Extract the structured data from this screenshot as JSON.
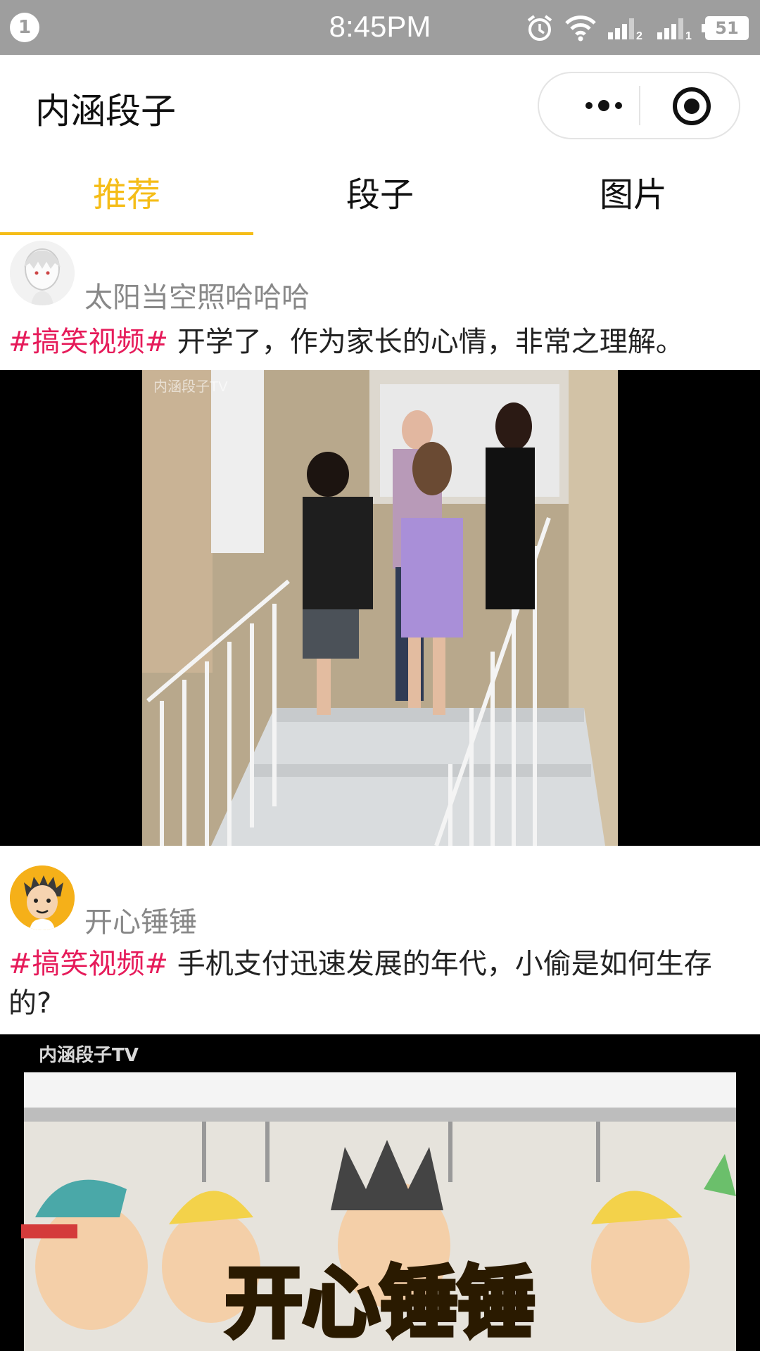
{
  "status_bar": {
    "notification_count": "1",
    "time": "8:45PM",
    "battery": "51",
    "sim1_label": "2",
    "sim2_label": "1"
  },
  "app": {
    "title": "内涵段子"
  },
  "tabs": [
    {
      "label": "推荐",
      "active": true
    },
    {
      "label": "段子",
      "active": false
    },
    {
      "label": "图片",
      "active": false
    }
  ],
  "colors": {
    "accent": "#f5bd18",
    "tag": "#e61b5a",
    "status_bar_bg": "#9e9e9e"
  },
  "posts": [
    {
      "username": "太阳当空照哈哈哈",
      "tag": "#搞笑视频#",
      "text": "开学了，作为家长的心情，非常之理解。",
      "media_watermark": "内涵段子TV"
    },
    {
      "username": "开心锤锤",
      "tag": "#搞笑视频#",
      "text": "手机支付迅速发展的年代，小偷是如何生存的?",
      "media_watermark": "内涵段子TV",
      "media_title": "开心锤锤"
    }
  ]
}
